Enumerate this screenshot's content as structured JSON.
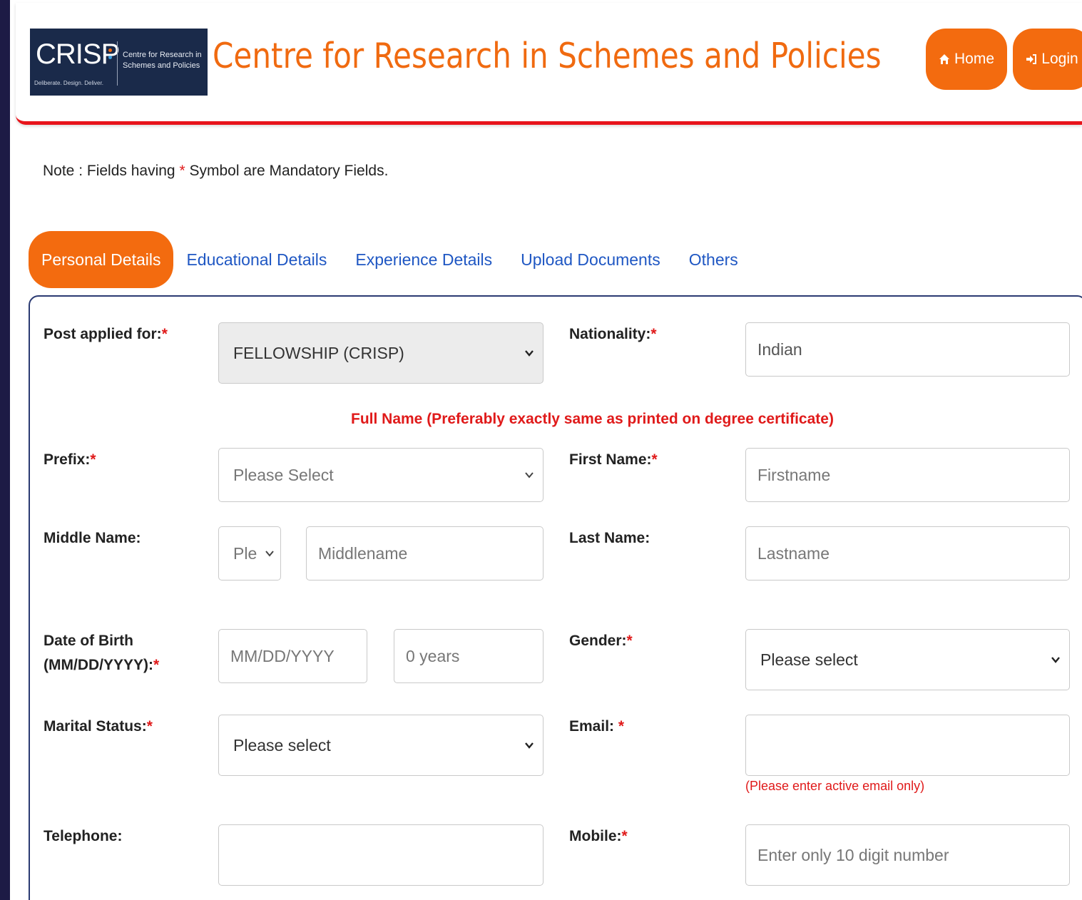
{
  "header": {
    "logo": {
      "main": "CRISP",
      "side_line1": "Centre for Research in",
      "side_line2": "Schemes and Policies",
      "tagline": "Deliberate. Design. Deliver."
    },
    "title": "Centre for Research in Schemes and Policies",
    "home_label": "Home",
    "login_label": "Login",
    "accent_color": "#f36b0f"
  },
  "note": {
    "prefix": "Note : Fields having ",
    "star": "*",
    "suffix": " Symbol are Mandatory Fields."
  },
  "tabs": [
    {
      "label": "Personal Details",
      "active": true
    },
    {
      "label": "Educational Details",
      "active": false
    },
    {
      "label": "Experience Details",
      "active": false
    },
    {
      "label": "Upload Documents",
      "active": false
    },
    {
      "label": "Others",
      "active": false
    }
  ],
  "form": {
    "post_label": "Post applied for:",
    "post_value": "FELLOWSHIP (CRISP)",
    "nationality_label": "Nationality:",
    "nationality_value": "Indian",
    "fullname_note": "Full Name (Preferably exactly same as printed on degree certificate)",
    "prefix_label": "Prefix:",
    "prefix_value": "Please Select",
    "first_name_label": "First Name:",
    "first_name_placeholder": "Firstname",
    "middle_name_label": "Middle Name:",
    "middle_prefix_value": "Ple",
    "middle_name_placeholder": "Middlename",
    "last_name_label": "Last Name:",
    "last_name_placeholder": "Lastname",
    "dob_label_line1": "Date of Birth",
    "dob_label_line2": "(MM/DD/YYYY):",
    "dob_placeholder": "MM/DD/YYYY",
    "age_value": "0 years",
    "gender_label": "Gender:",
    "gender_value": "Please select",
    "marital_label": "Marital Status:",
    "marital_value": "Please select",
    "email_label": "Email: ",
    "email_value": "",
    "email_hint": "(Please enter active email only)",
    "telephone_label": "Telephone:",
    "telephone_value": "",
    "mobile_label": "Mobile:",
    "mobile_placeholder": "Enter only 10 digit number",
    "required_mark": "*"
  }
}
